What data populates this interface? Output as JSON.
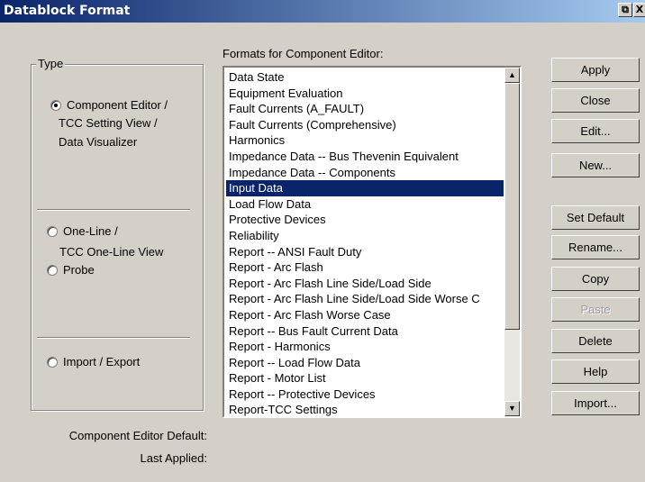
{
  "window": {
    "title": "Datablock Format",
    "restore_glyph": "⧉",
    "close_glyph": "X"
  },
  "type_group": {
    "legend": "Type",
    "options": [
      {
        "label_lines": [
          "Component Editor /",
          "TCC Setting View /",
          "Data Visualizer"
        ],
        "checked": true
      },
      {
        "label_lines": [
          "One-Line /",
          "TCC One-Line View"
        ],
        "checked": false
      },
      {
        "label_lines": [
          "Probe"
        ],
        "checked": false
      },
      {
        "label_lines": [
          "Import / Export"
        ],
        "checked": false
      }
    ]
  },
  "formats": {
    "label": "Formats for Component Editor:",
    "items": [
      "Data State",
      "Equipment Evaluation",
      "Fault Currents (A_FAULT)",
      "Fault Currents (Comprehensive)",
      "Harmonics",
      "Impedance Data -- Bus Thevenin Equivalent",
      "Impedance Data -- Components",
      "Input Data",
      "Load Flow Data",
      "Protective Devices",
      "Reliability",
      "Report -- ANSI Fault Duty",
      "Report - Arc Flash",
      "Report - Arc Flash Line Side/Load Side",
      "Report - Arc Flash Line Side/Load Side Worse C",
      "Report - Arc Flash Worse Case",
      "Report -- Bus Fault Current Data",
      "Report - Harmonics",
      "Report -- Load Flow Data",
      "Report - Motor List",
      "Report -- Protective Devices",
      "Report-TCC Settings"
    ],
    "selected": "Input Data"
  },
  "buttons": {
    "apply": "Apply",
    "close": "Close",
    "edit": "Edit...",
    "new": "New...",
    "set_default": "Set Default",
    "rename": "Rename...",
    "copy": "Copy",
    "paste": "Paste",
    "delete": "Delete",
    "help": "Help",
    "import": "Import..."
  },
  "footer": {
    "default_label": "Component Editor Default:",
    "last_applied_label": "Last Applied:"
  }
}
